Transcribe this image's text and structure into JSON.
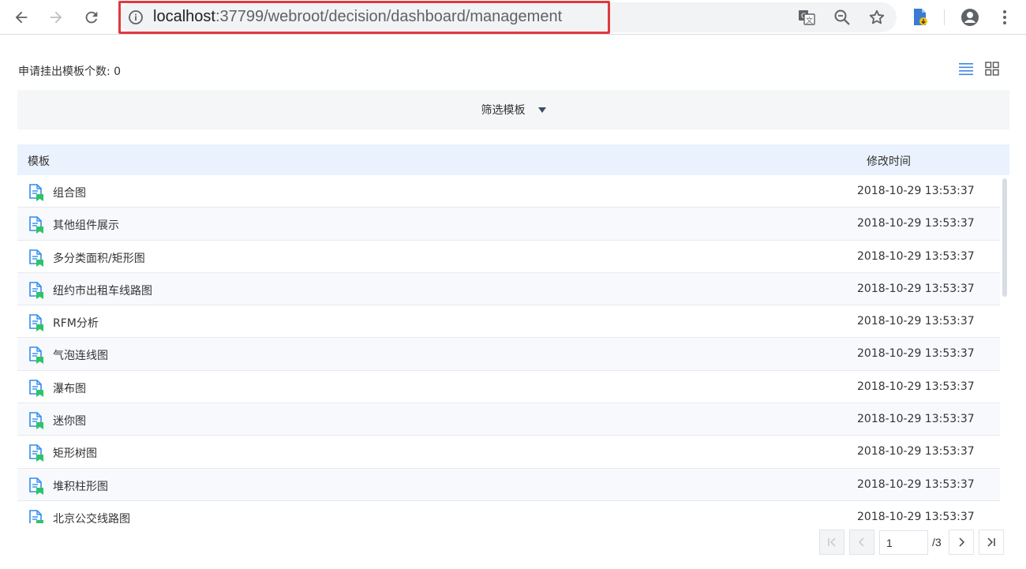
{
  "browser": {
    "url_host": "localhost",
    "url_path": ":37799/webroot/decision/dashboard/management",
    "icons": [
      "back-icon",
      "forward-icon",
      "reload-icon",
      "info-icon",
      "translate-icon",
      "zoom-icon",
      "star-icon",
      "extension-icon",
      "account-icon",
      "menu-icon"
    ]
  },
  "app": {
    "pending_label": "申请挂出模板个数: 0",
    "filter_label": "筛选模板",
    "table": {
      "columns": {
        "name": "模板",
        "time": "修改时间"
      },
      "rows": [
        {
          "name": "组合图",
          "time": "2018-10-29 13:53:37"
        },
        {
          "name": "其他组件展示",
          "time": "2018-10-29 13:53:37"
        },
        {
          "name": "多分类面积/矩形图",
          "time": "2018-10-29 13:53:37"
        },
        {
          "name": "纽约市出租车线路图",
          "time": "2018-10-29 13:53:37"
        },
        {
          "name": "RFM分析",
          "time": "2018-10-29 13:53:37"
        },
        {
          "name": "气泡连线图",
          "time": "2018-10-29 13:53:37"
        },
        {
          "name": "瀑布图",
          "time": "2018-10-29 13:53:37"
        },
        {
          "name": "迷你图",
          "time": "2018-10-29 13:53:37"
        },
        {
          "name": "矩形树图",
          "time": "2018-10-29 13:53:37"
        },
        {
          "name": "堆积柱形图",
          "time": "2018-10-29 13:53:37"
        },
        {
          "name": "北京公交线路图",
          "time": "2018-10-29 13:53:37"
        }
      ]
    },
    "pagination": {
      "current": "1",
      "total": "/3"
    }
  },
  "colors": {
    "url_highlight": "#e0393e",
    "file_icon_blue": "#2f8cf0",
    "file_icon_green": "#2ec36b",
    "header_bg": "#eaf2fd",
    "accent": "#3d86e0"
  }
}
